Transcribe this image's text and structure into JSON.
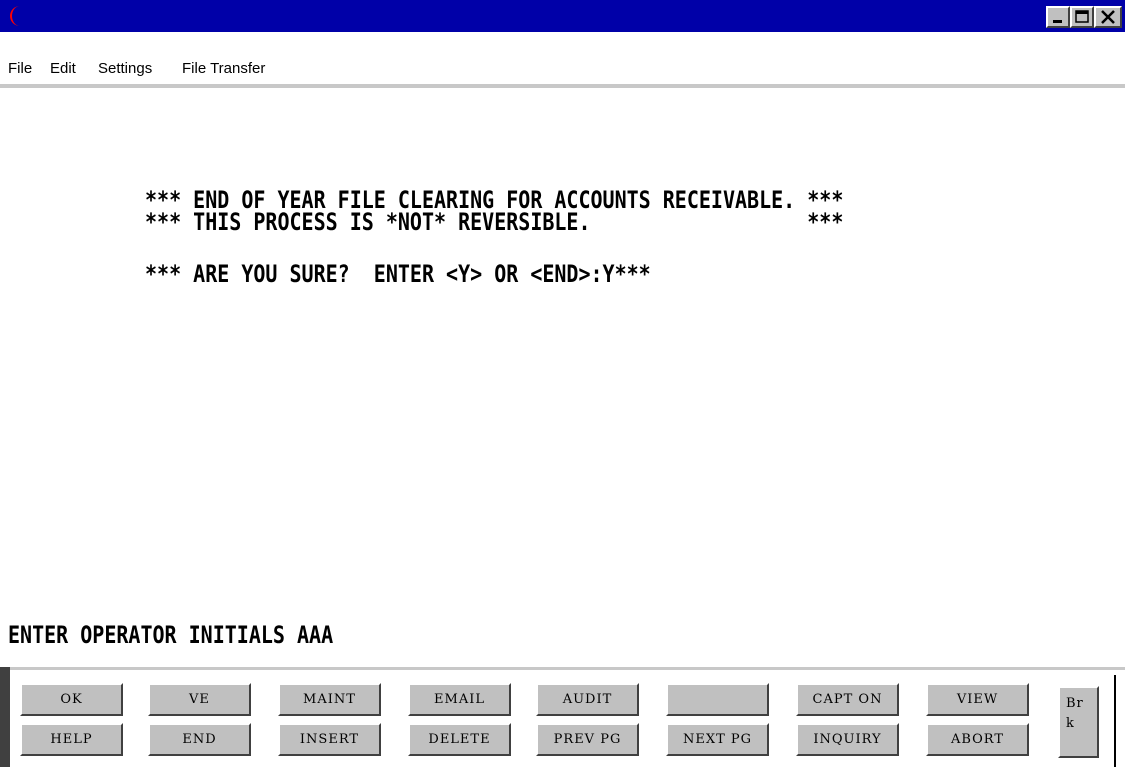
{
  "colors": {
    "titlebar": "#0000a8",
    "app_icon": "#ff0000",
    "button_face": "#c0c0c0",
    "screen_bg": "#ffffff",
    "screen_text": "#000000"
  },
  "window": {
    "icons": [
      "app-moon-icon",
      "minimize-icon",
      "maximize-icon",
      "close-icon"
    ]
  },
  "menu": {
    "file": "File",
    "edit": "Edit",
    "settings": "Settings",
    "file_transfer": "File Transfer"
  },
  "screen": {
    "line1": "*** END OF YEAR FILE CLEARING FOR ACCOUNTS RECEIVABLE. ***",
    "line2": "*** THIS PROCESS IS *NOT* REVERSIBLE.                  ***",
    "line3": "*** ARE YOU SURE?  ENTER <Y> OR <END>:Y***",
    "operator_line": "ENTER OPERATOR INITIALS AAA"
  },
  "function_keys": {
    "row1": [
      "OK",
      "VE",
      "MAINT",
      "EMAIL",
      "AUDIT",
      "",
      "CAPT ON",
      "VIEW"
    ],
    "row2": [
      "HELP",
      "END",
      "INSERT",
      "DELETE",
      "PREV PG",
      "NEXT PG",
      "INQUIRY",
      "ABORT"
    ],
    "brk_line1": "Br",
    "brk_line2": "k"
  }
}
